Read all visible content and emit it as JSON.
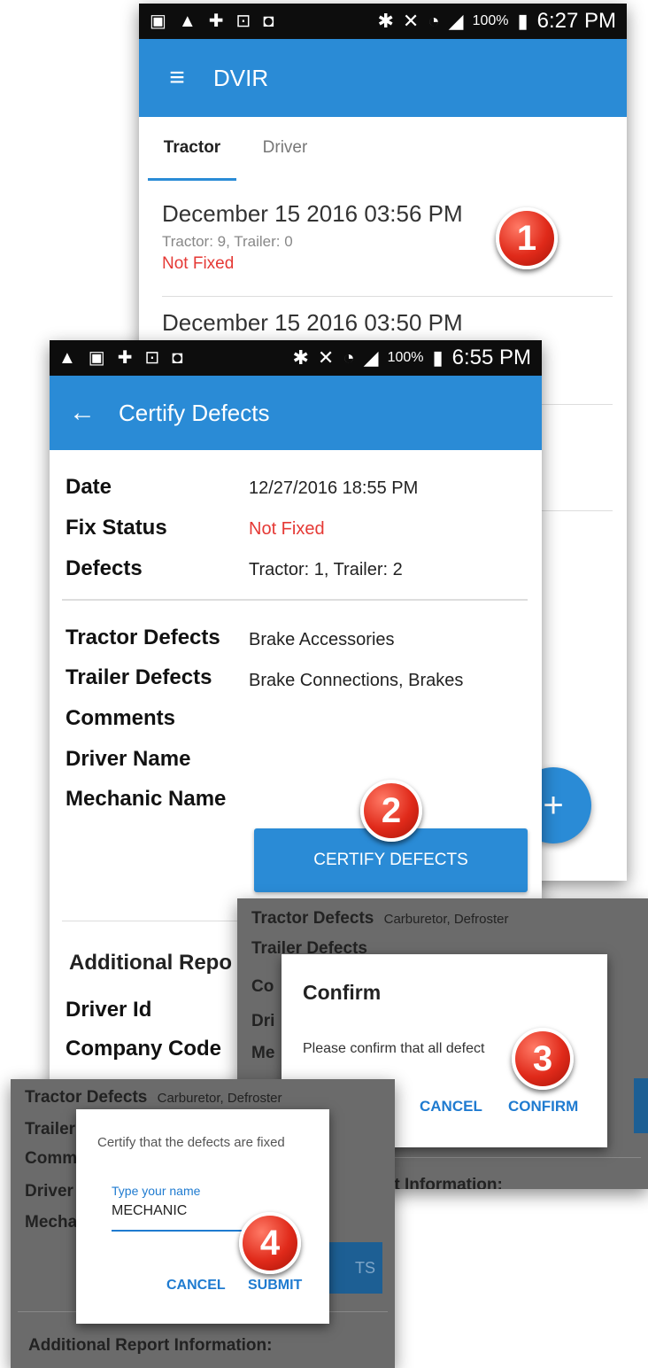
{
  "screen1": {
    "status": {
      "icons": [
        "gallery-icon",
        "warning-icon",
        "plus-circle-icon",
        "clipboard-icon",
        "briefcase-icon"
      ],
      "right_icons": [
        "bluetooth-icon",
        "mute-icon",
        "wifi-icon",
        "signal-icon"
      ],
      "battery": "100%",
      "time": "6:27 PM"
    },
    "title": "DVIR",
    "tabs": [
      "Tractor",
      "Driver"
    ],
    "entries": [
      {
        "date": "December 15 2016 03:56 PM",
        "counts": "Tractor: 9, Trailer: 0",
        "status": "Not Fixed"
      },
      {
        "date": "December 15 2016 03:50 PM"
      }
    ],
    "fab": "+"
  },
  "screen2": {
    "status": {
      "battery": "100%",
      "time": "6:55 PM"
    },
    "title": "Certify Defects",
    "fields": {
      "date_label": "Date",
      "date_value": "12/27/2016 18:55 PM",
      "fix_label": "Fix Status",
      "fix_value": "Not Fixed",
      "defects_label": "Defects",
      "defects_value": "Tractor: 1, Trailer: 2",
      "tractor_label": "Tractor Defects",
      "tractor_value": "Brake Accessories",
      "trailer_label": "Trailer Defects",
      "trailer_value": "Brake Connections, Brakes",
      "comments_label": "Comments",
      "driver_name_label": "Driver Name",
      "mechanic_label": "Mechanic Name"
    },
    "certify_button": "CERTIFY DEFECTS",
    "additional_label": "Additional Repo",
    "driver_id_label": "Driver Id",
    "company_code_label": "Company Code"
  },
  "screen3": {
    "bg_tractor_label": "Tractor Defects",
    "bg_tractor_value": "Carburetor, Defroster",
    "bg_trailer": "Trailer Defects",
    "bg_co": "Co",
    "bg_dri": "Dri",
    "bg_me": "Me",
    "bg_additional": "rt Information:",
    "dialog_title": "Confirm",
    "dialog_message": "Please confirm that all defect",
    "dialog_message_tail": "ed",
    "cancel": "CANCEL",
    "confirm": "CONFIRM"
  },
  "screen4": {
    "bg_tractor_label": "Tractor Defects",
    "bg_tractor_value": "Carburetor, Defroster",
    "bg_trailer": "Trailer",
    "bg_comm": "Comm",
    "bg_driver": "Driver",
    "bg_mecha": "Mecha",
    "bg_button_tail": "TS",
    "bg_additional": "Additional Report Information:",
    "dialog_message": "Certify that the defects are fixed",
    "input_label": "Type your name",
    "input_value": "MECHANIC",
    "cancel": "CANCEL",
    "submit": "SUBMIT"
  },
  "badges": [
    "1",
    "2",
    "3",
    "4"
  ],
  "colors": {
    "accent": "#2a8bd6",
    "error": "#e53935",
    "link": "#1f7bd0"
  }
}
